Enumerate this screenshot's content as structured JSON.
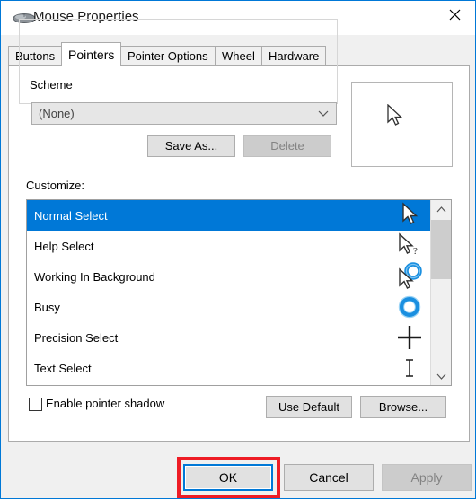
{
  "window": {
    "title": "Mouse Properties",
    "icon": "mouse-icon",
    "close_icon": "close-icon",
    "border_color": "#0078d7"
  },
  "tabs": [
    {
      "label": "Buttons",
      "active": false
    },
    {
      "label": "Pointers",
      "active": true
    },
    {
      "label": "Pointer Options",
      "active": false
    },
    {
      "label": "Wheel",
      "active": false
    },
    {
      "label": "Hardware",
      "active": false
    }
  ],
  "scheme": {
    "legend": "Scheme",
    "combo_value": "(None)",
    "combo_arrow_icon": "chevron-down-icon",
    "save_as_label": "Save As...",
    "delete_label": "Delete",
    "delete_disabled": true
  },
  "customize": {
    "label": "Customize:",
    "selected_index": 0,
    "items": [
      {
        "label": "Normal Select",
        "cursor": "arrow-cursor"
      },
      {
        "label": "Help Select",
        "cursor": "arrow-question-cursor"
      },
      {
        "label": "Working In Background",
        "cursor": "arrow-busy-cursor"
      },
      {
        "label": "Busy",
        "cursor": "busy-ring-cursor"
      },
      {
        "label": "Precision Select",
        "cursor": "crosshair-cursor"
      },
      {
        "label": "Text Select",
        "cursor": "ibeam-cursor"
      }
    ],
    "scrollbar": {
      "up_icon": "chevron-up-icon",
      "down_icon": "chevron-down-icon"
    }
  },
  "preview": {
    "cursor": "arrow-cursor"
  },
  "options": {
    "shadow_label": "Enable pointer shadow",
    "shadow_checked": false,
    "use_default_label": "Use Default",
    "browse_label": "Browse..."
  },
  "footer": {
    "ok_label": "OK",
    "cancel_label": "Cancel",
    "apply_label": "Apply",
    "apply_disabled": true,
    "ok_focused": true,
    "annotation_color": "#ee1c25"
  },
  "colors": {
    "selection": "#0078d7",
    "dialog_bg": "#f0f0f0",
    "page_bg": "#ffffff"
  }
}
